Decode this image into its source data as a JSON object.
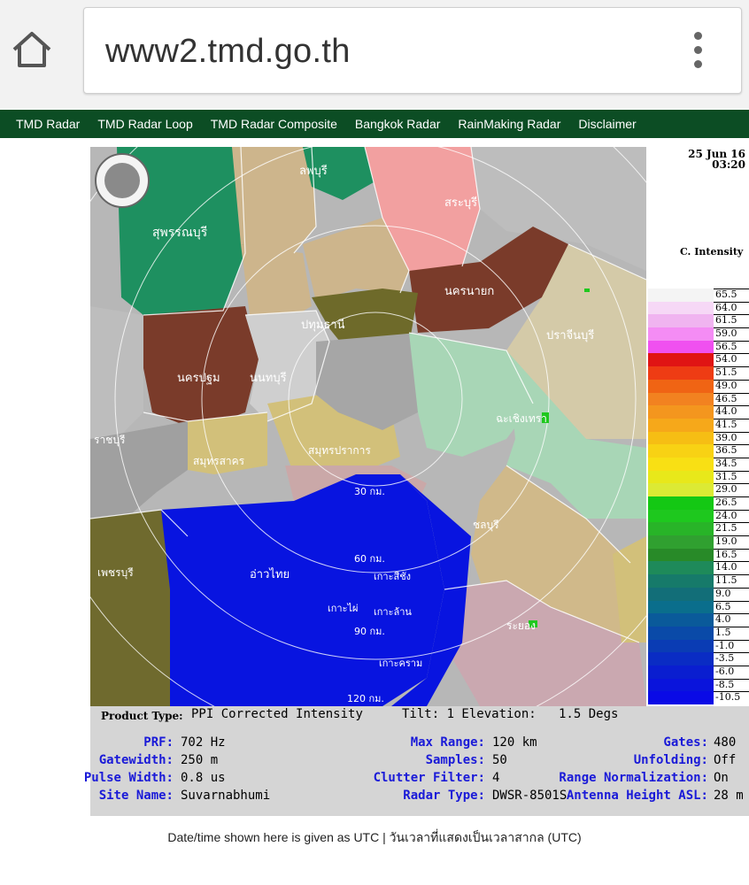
{
  "browser": {
    "url": "www2.tmd.go.th"
  },
  "nav": {
    "items": [
      "TMD Radar",
      "TMD Radar Loop",
      "TMD Radar Composite",
      "Bangkok Radar",
      "RainMaking Radar",
      "Disclaimer"
    ]
  },
  "radar": {
    "date": "25 Jun 16",
    "time": "03:20",
    "legend_title": "C. Intensity",
    "scale": [
      {
        "value": "65.5",
        "color": "#f4f4f4"
      },
      {
        "value": "64.0",
        "color": "#f6d8f6"
      },
      {
        "value": "61.5",
        "color": "#f0b4f0"
      },
      {
        "value": "59.0",
        "color": "#f48cf4"
      },
      {
        "value": "56.5",
        "color": "#f050f0"
      },
      {
        "value": "54.0",
        "color": "#e01414"
      },
      {
        "value": "51.5",
        "color": "#ee3c14"
      },
      {
        "value": "49.0",
        "color": "#f06414"
      },
      {
        "value": "46.5",
        "color": "#f28220"
      },
      {
        "value": "44.0",
        "color": "#f4961e"
      },
      {
        "value": "41.5",
        "color": "#f6a81a"
      },
      {
        "value": "39.0",
        "color": "#f6be14"
      },
      {
        "value": "36.5",
        "color": "#f8d214"
      },
      {
        "value": "34.5",
        "color": "#f8e014"
      },
      {
        "value": "31.5",
        "color": "#e8e81a"
      },
      {
        "value": "29.0",
        "color": "#dcea34"
      },
      {
        "value": "26.5",
        "color": "#14c814"
      },
      {
        "value": "24.0",
        "color": "#1ec81e"
      },
      {
        "value": "21.5",
        "color": "#28b428"
      },
      {
        "value": "19.0",
        "color": "#30a030"
      },
      {
        "value": "16.5",
        "color": "#288a28"
      },
      {
        "value": "14.0",
        "color": "#1e8a5a"
      },
      {
        "value": "11.5",
        "color": "#167a6a"
      },
      {
        "value": "9.0",
        "color": "#126e78"
      },
      {
        "value": "6.5",
        "color": "#0a6e8c"
      },
      {
        "value": "4.0",
        "color": "#0a5a9a"
      },
      {
        "value": "1.5",
        "color": "#0a4aa8"
      },
      {
        "value": "-1.0",
        "color": "#0a3cb4"
      },
      {
        "value": "-3.5",
        "color": "#0a2cc4"
      },
      {
        "value": "-6.0",
        "color": "#0a1ed0"
      },
      {
        "value": "-8.5",
        "color": "#0a14dc"
      },
      {
        "value": "-10.5",
        "color": "#0a0ae6"
      }
    ],
    "map_labels": {
      "nonthaburi": "นนทบุรี",
      "pathumthani": "ปทุมธานี",
      "nakhonpathom": "นครปฐม",
      "samutsakhon": "สมุทรสาคร",
      "samutprakan": "สมุทรปราการ",
      "chachoengsao": "ฉะเชิงเทรา",
      "chonburi": "ชลบุรี",
      "gulf": "อ่าวไทย",
      "nakhonnayok": "นครนายก",
      "prachinburi": "ปราจีนบุรี",
      "suphanburi": "สุพรรณบุรี",
      "lopburi": "ลพบุรี",
      "saraburi": "สระบุรี",
      "ratchaburi": "ราชบุรี",
      "phetchaburi": "เพชรบุรี",
      "rayong": "ระยอง",
      "kokhram": "เกาะคราม",
      "kosichang": "เกาะสีชัง",
      "kolan": "เกาะล้าน",
      "kophai": "เกาะไผ่",
      "r30": "30 กม.",
      "r60": "60 กม.",
      "r90": "90 กม.",
      "r120": "120 กม."
    }
  },
  "product": {
    "type_label": "Product Type:",
    "type_code": "PPI",
    "type_name": "Corrected Intensity",
    "tilt": "Tilt: 1 Elevation:   1.5 Degs"
  },
  "params": [
    {
      "key": "PRF:",
      "value": "702 Hz"
    },
    {
      "key": "Gatewidth:",
      "value": "250 m"
    },
    {
      "key": "Pulse Width:",
      "value": "0.8 us"
    },
    {
      "key": "Site Name:",
      "value": "Suvarnabhumi"
    },
    {
      "key": "Max Range:",
      "value": "120 km"
    },
    {
      "key": "Samples:",
      "value": "50"
    },
    {
      "key": "Clutter Filter:",
      "value": "4"
    },
    {
      "key": "Radar Type:",
      "value": "DWSR-8501S"
    },
    {
      "key": "Gates:",
      "value": "480"
    },
    {
      "key": "Unfolding:",
      "value": "Off"
    },
    {
      "key": "Range Normalization:",
      "value": "On"
    },
    {
      "key": "Antenna Height ASL:",
      "value": "28 m"
    }
  ],
  "footer": "Date/time shown here is given as UTC | วันเวลาที่แสดงเป็นเวลาสากล (UTC)"
}
